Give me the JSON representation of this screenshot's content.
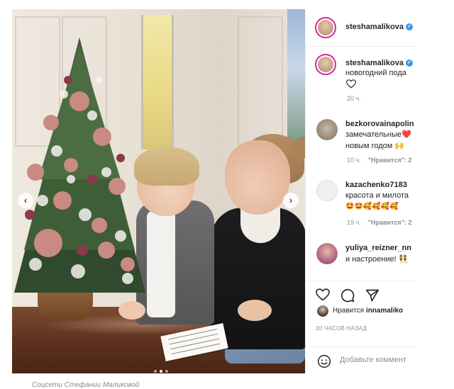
{
  "post": {
    "photo_alt": "",
    "carousel": {
      "prev_icon": "chevron-left-icon",
      "next_icon": "chevron-right-icon",
      "dot_count": 3,
      "active_dot": 1
    }
  },
  "header": {
    "username": "steshamalikova",
    "verified": true
  },
  "caption_comment": {
    "username": "steshamalikova",
    "text": "новогодний пода",
    "time": "20 ч."
  },
  "comments": [
    {
      "username": "bezkorovainapolin",
      "text_line1": "замечательные",
      "text_line2": "новым годом",
      "emoji1": "❤️",
      "emoji2": "🙌",
      "time": "10 ч.",
      "likes": "\"Нравится\": 2"
    },
    {
      "username": "kazachenko7183",
      "text_line1": "красота и милота",
      "emojis": "🤩🤩🥰🥰🥰🥰",
      "time": "19 ч.",
      "likes": "\"Нравится\": 2"
    },
    {
      "username": "yuliya_reizner_nn",
      "text_line1": "и настроение!",
      "emoji1": "👯"
    }
  ],
  "actions": {
    "like_icon": "heart-icon",
    "comment_icon": "comment-icon",
    "share_icon": "share-icon"
  },
  "likes": {
    "prefix": "Нравится",
    "user": "innamaliko"
  },
  "timestamp": "20 ЧАСОВ НАЗАД",
  "comment_input": {
    "placeholder": "Добавьте коммент",
    "emoji_icon": "smiley-icon"
  },
  "caption": "Соцсети Стефании Маликовой",
  "colors": {
    "verified": "#3897f0",
    "story_ring": "#d6249f",
    "meta_text": "#8e8e8e"
  }
}
